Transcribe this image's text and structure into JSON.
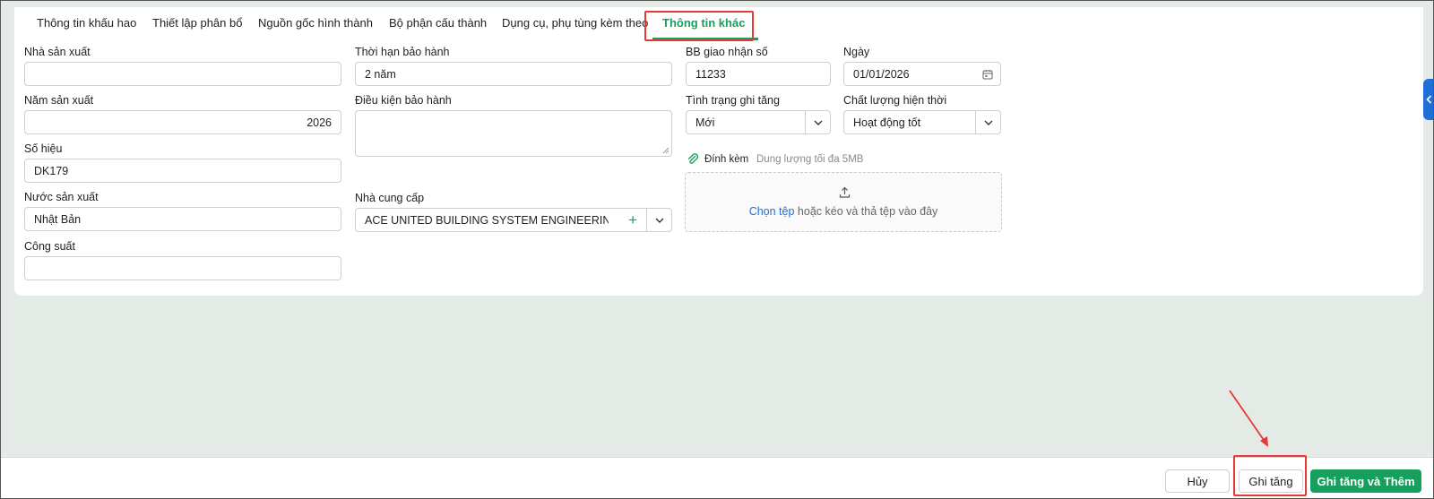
{
  "tabs": [
    {
      "label": "Thông tin khấu hao"
    },
    {
      "label": "Thiết lập phân bổ"
    },
    {
      "label": "Nguồn gốc hình thành"
    },
    {
      "label": "Bộ phận cấu thành"
    },
    {
      "label": "Dụng cụ, phụ tùng kèm theo"
    },
    {
      "label": "Thông tin khác",
      "active": true
    }
  ],
  "fields": {
    "manufacturer": {
      "label": "Nhà sản xuất",
      "value": ""
    },
    "year": {
      "label": "Năm sản xuất",
      "value": "2026"
    },
    "serial": {
      "label": "Số hiệu",
      "value": "DK179"
    },
    "country": {
      "label": "Nước sản xuất",
      "value": "Nhật Bản"
    },
    "capacity": {
      "label": "Công suất",
      "value": ""
    },
    "warranty_period": {
      "label": "Thời hạn bảo hành",
      "value": "2 năm"
    },
    "warranty_terms": {
      "label": "Điều kiện bảo hành",
      "value": ""
    },
    "supplier": {
      "label": "Nhà cung cấp",
      "value": "ACE UNITED BUILDING SYSTEM ENGINEERING ..."
    },
    "handover_no": {
      "label": "BB giao nhận số",
      "value": "11233"
    },
    "date": {
      "label": "Ngày",
      "value": "01/01/2026"
    },
    "increase_status": {
      "label": "Tình trạng ghi tăng",
      "value": "Mới"
    },
    "quality": {
      "label": "Chất lượng hiện thời",
      "value": "Hoạt động tốt"
    }
  },
  "attachment": {
    "label": "Đính kèm",
    "hint": "Dung lượng tối đa 5MB",
    "choose_file": "Chọn tệp",
    "drop_text": "hoặc kéo và thả tệp vào đây"
  },
  "footer": {
    "cancel": "Hủy",
    "save": "Ghi tăng",
    "save_and_add": "Ghi tăng và Thêm"
  },
  "colors": {
    "accent": "#17a05d",
    "link": "#1f6fd6",
    "highlight": "#e53935"
  },
  "icons": {
    "calendar": "calendar-icon",
    "chevron": "chevron-down-icon",
    "plus": "plus-icon",
    "paperclip": "paperclip-icon",
    "upload": "upload-icon"
  }
}
